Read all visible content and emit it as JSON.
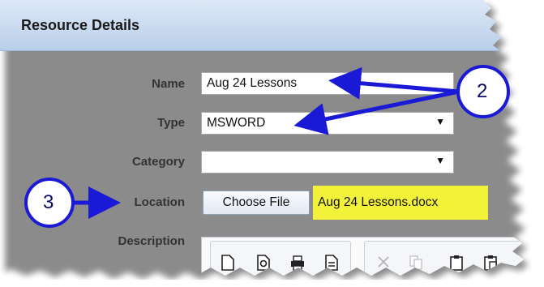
{
  "panel": {
    "title": "Resource Details"
  },
  "form": {
    "name_label": "Name",
    "name_value": "Aug 24 Lessons",
    "type_label": "Type",
    "type_value": "MSWORD",
    "category_label": "Category",
    "category_value": "",
    "location_label": "Location",
    "choose_file_label": "Choose File",
    "file_name": "Aug 24 Lessons.docx",
    "description_label": "Description"
  },
  "callouts": {
    "two": "2",
    "three": "3"
  },
  "colors": {
    "header_top": "#dde9f7",
    "header_bottom": "#b9cfea",
    "highlight": "#f2f23a",
    "arrow": "#1a1ad6",
    "callout_fill": "#ffffff",
    "callout_stroke": "#1a1ad6"
  },
  "icons": {
    "dropdown": "caret-down-icon",
    "toolbar": [
      "new-document-icon",
      "preview-icon",
      "print-icon",
      "template-icon",
      "cut-icon",
      "copy-icon",
      "paste-icon",
      "paste-text-icon"
    ]
  }
}
